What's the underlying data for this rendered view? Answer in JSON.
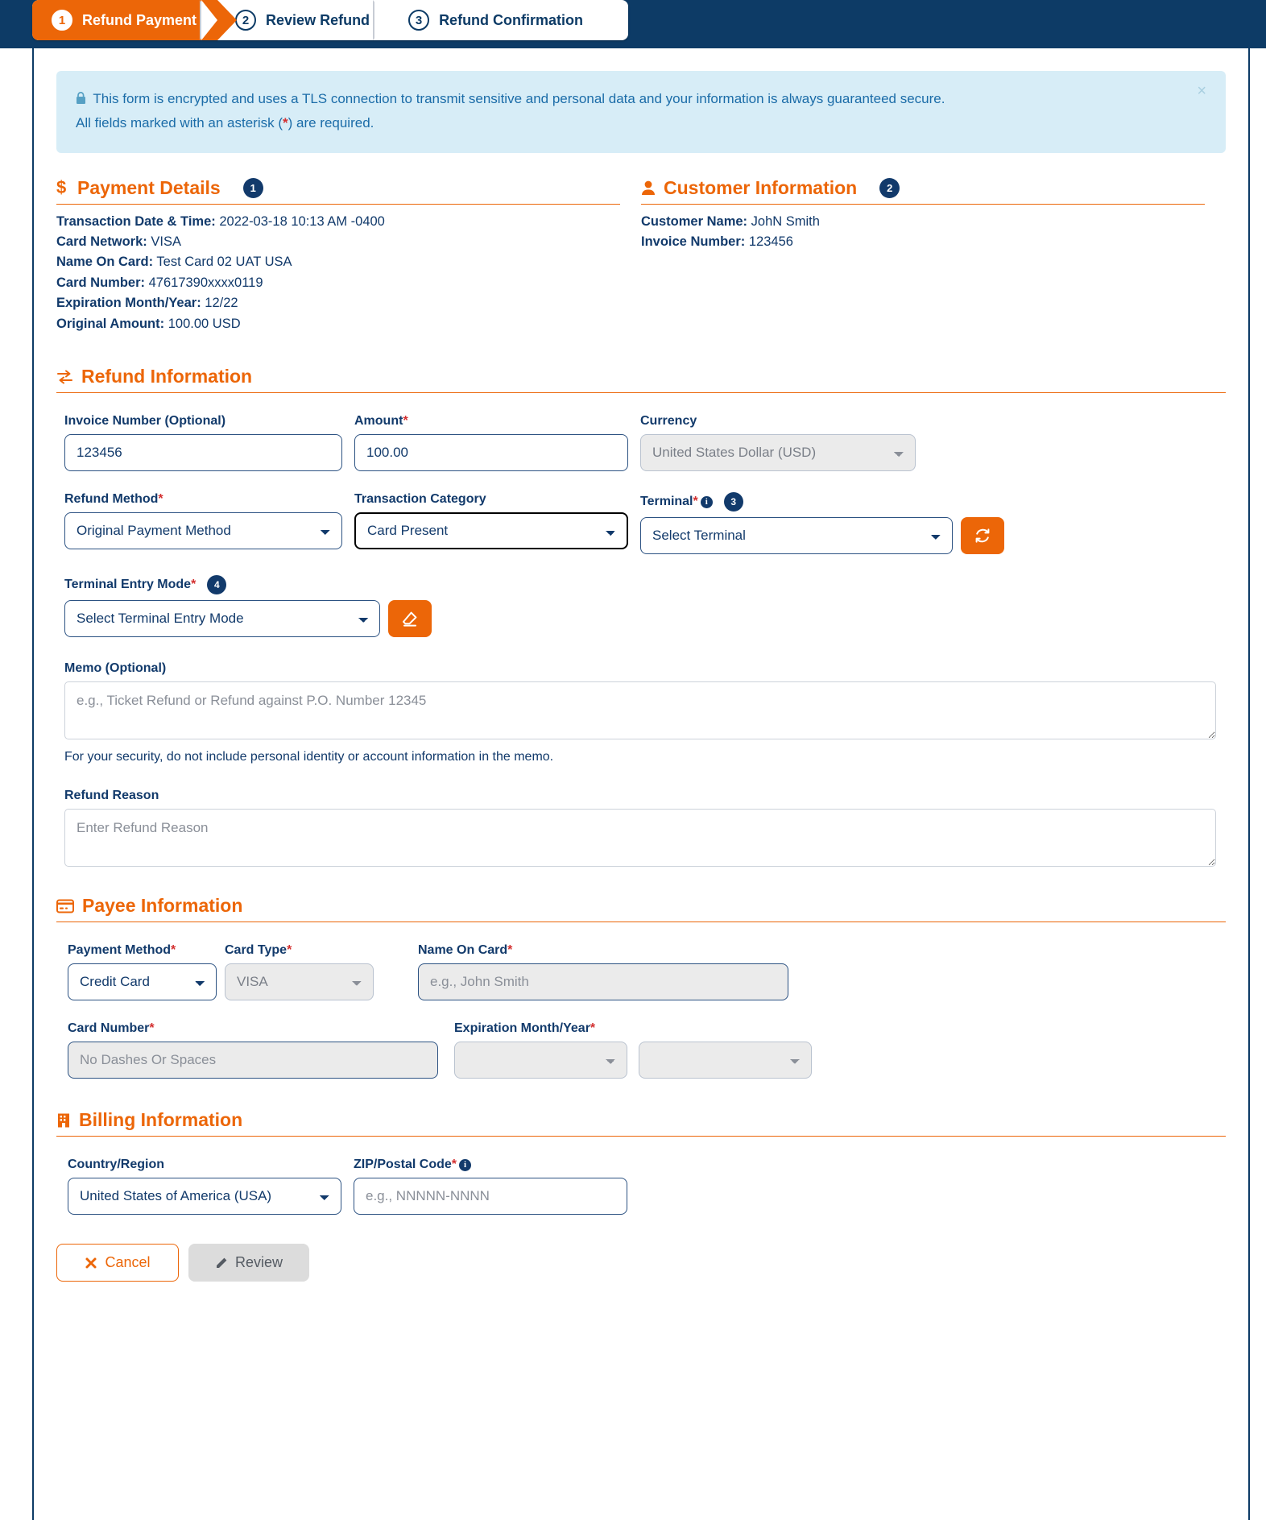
{
  "wizard": {
    "steps": [
      {
        "num": "1",
        "label": "Refund Payment",
        "active": true
      },
      {
        "num": "2",
        "label": "Review Refund",
        "active": false
      },
      {
        "num": "3",
        "label": "Refund Confirmation",
        "active": false
      }
    ]
  },
  "alert": {
    "lock_icon": "lock-icon",
    "line1": "This form is encrypted and uses a TLS connection to transmit sensitive and personal data and your information is always guaranteed secure.",
    "line2_before": "All fields marked with an asterisk (",
    "line2_asterisk": "*",
    "line2_after": ") are required.",
    "close_label": "×"
  },
  "payment_details": {
    "icon": "dollar-icon",
    "title": "Payment Details",
    "badge": "1",
    "rows": [
      {
        "label": "Transaction Date & Time:",
        "value": "2022-03-18 10:13 AM -0400"
      },
      {
        "label": "Card Network:",
        "value": "VISA"
      },
      {
        "label": "Name On Card:",
        "value": "Test Card 02 UAT USA"
      },
      {
        "label": "Card Number:",
        "value": "47617390xxxx0119"
      },
      {
        "label": "Expiration Month/Year:",
        "value": "12/22"
      },
      {
        "label": "Original Amount:",
        "value": "100.00 USD"
      }
    ]
  },
  "customer_information": {
    "icon": "user-icon",
    "title": "Customer Information",
    "badge": "2",
    "rows": [
      {
        "label": "Customer Name:",
        "value": "JohN Smith"
      },
      {
        "label": "Invoice Number:",
        "value": "123456"
      }
    ]
  },
  "refund_information": {
    "icon": "exchange-icon",
    "title": "Refund Information",
    "invoice_number": {
      "label": "Invoice Number (Optional)",
      "value": "123456",
      "placeholder": ""
    },
    "amount": {
      "label": "Amount",
      "required": "*",
      "value": "100.00",
      "placeholder": ""
    },
    "currency": {
      "label": "Currency",
      "value": "United States Dollar (USD)",
      "disabled": true
    },
    "refund_method": {
      "label": "Refund Method",
      "required": "*",
      "value": "Original Payment Method"
    },
    "transaction_category": {
      "label": "Transaction Category",
      "value": "Card Present",
      "focused": true
    },
    "terminal": {
      "label": "Terminal",
      "required": "*",
      "info_icon": "info-icon",
      "badge": "3",
      "value": "Select Terminal",
      "refresh_button_icon": "refresh-icon"
    },
    "terminal_entry_mode": {
      "label": "Terminal Entry Mode",
      "required": "*",
      "badge": "4",
      "value": "Select Terminal Entry Mode",
      "clear_button_icon": "eraser-icon"
    },
    "memo": {
      "label": "Memo (Optional)",
      "placeholder": "e.g., Ticket Refund or Refund against P.O. Number 12345",
      "value": "",
      "help": "For your security, do not include personal identity or account information in the memo."
    },
    "refund_reason": {
      "label": "Refund Reason",
      "placeholder": "Enter Refund Reason",
      "value": ""
    }
  },
  "payee_information": {
    "icon": "credit-card-icon",
    "title": "Payee Information",
    "payment_method": {
      "label": "Payment Method",
      "required": "*",
      "value": "Credit Card"
    },
    "card_type": {
      "label": "Card Type",
      "required": "*",
      "value": "VISA",
      "disabled": true
    },
    "name_on_card": {
      "label": "Name On Card",
      "required": "*",
      "placeholder": "e.g., John Smith",
      "value": "",
      "disabled": true
    },
    "card_number": {
      "label": "Card Number",
      "required": "*",
      "placeholder": "No Dashes Or Spaces",
      "value": "",
      "disabled": true
    },
    "expiration": {
      "label": "Expiration Month/Year",
      "required": "*",
      "month_value": "",
      "year_value": "",
      "disabled": true
    }
  },
  "billing_information": {
    "icon": "building-icon",
    "title": "Billing Information",
    "country": {
      "label": "Country/Region",
      "value": "United States of America (USA)"
    },
    "zip": {
      "label": "ZIP/Postal Code",
      "required": "*",
      "info_icon": "info-icon",
      "placeholder": "e.g., NNNNN-NNNN",
      "value": ""
    }
  },
  "actions": {
    "cancel_label": "Cancel",
    "cancel_icon": "x-icon",
    "review_label": "Review",
    "review_icon": "pencil-icon"
  },
  "colors": {
    "brand_orange": "#ec6608",
    "brand_navy": "#0d3b66",
    "alert_bg": "#d7edf7",
    "required_red": "#d32f2f"
  }
}
